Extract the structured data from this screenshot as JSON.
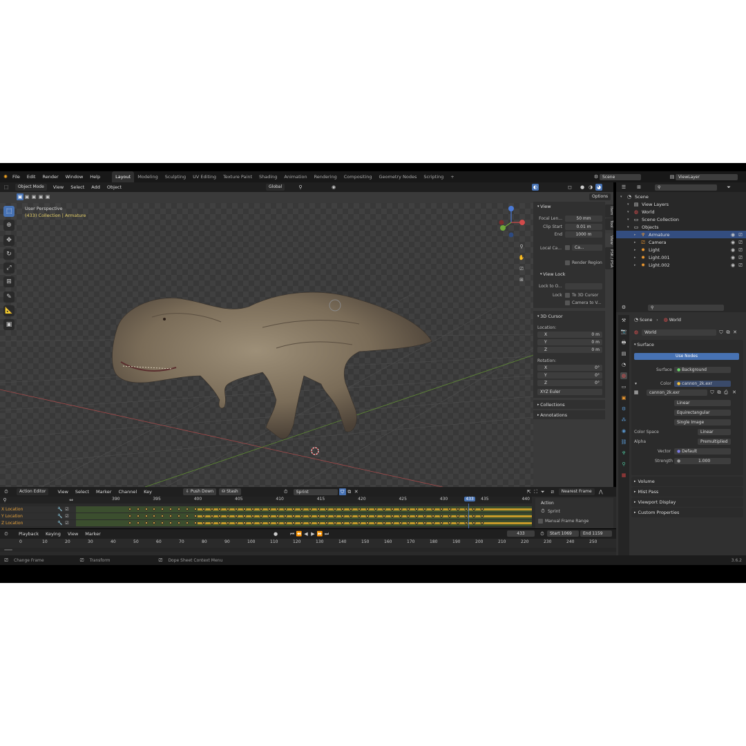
{
  "menu": {
    "items": [
      "File",
      "Edit",
      "Render",
      "Window",
      "Help"
    ]
  },
  "workspaces": [
    "Layout",
    "Modeling",
    "Sculpting",
    "UV Editing",
    "Texture Paint",
    "Shading",
    "Animation",
    "Rendering",
    "Compositing",
    "Geometry Nodes",
    "Scripting",
    "+"
  ],
  "scene": {
    "name": "Scene",
    "view_layer": "ViewLayer"
  },
  "viewport": {
    "mode": "Object Mode",
    "menus": [
      "View",
      "Select",
      "Add",
      "Object"
    ],
    "transform": "Global",
    "title": "User Perspective",
    "subtitle": "(433) Collection | Armature",
    "options": "Options"
  },
  "npanel": {
    "tabs": [
      "Item",
      "Tool",
      "View",
      "PSK / PSA"
    ],
    "view_header": "View",
    "focal_label": "Focal Len...",
    "focal_value": "50 mm",
    "clip_start_label": "Clip Start",
    "clip_start_value": "0.01 m",
    "end_label": "End",
    "end_value": "1000 m",
    "local_label": "Local Ca...",
    "local_value": "Ca...",
    "render_region": "Render Region",
    "view_lock_header": "View Lock",
    "lock_obj_label": "Lock to O...",
    "lock_label": "Lock",
    "to_cursor": "To 3D Cursor",
    "camera_to": "Camera to V...",
    "cursor_header": "3D Cursor",
    "location_label": "Location:",
    "loc": [
      {
        "axis": "X",
        "value": "0 m"
      },
      {
        "axis": "Y",
        "value": "0 m"
      },
      {
        "axis": "Z",
        "value": "0 m"
      }
    ],
    "rotation_label": "Rotation:",
    "rot": [
      {
        "axis": "X",
        "value": "0°"
      },
      {
        "axis": "Y",
        "value": "0°"
      },
      {
        "axis": "Z",
        "value": "0°"
      }
    ],
    "rot_mode": "XYZ Euler",
    "collections": "Collections",
    "annotations": "Annotations"
  },
  "outliner": {
    "rows": [
      {
        "label": "Scene",
        "indent": 0
      },
      {
        "label": "View Layers",
        "indent": 1
      },
      {
        "label": "World",
        "indent": 1
      },
      {
        "label": "Scene Collection",
        "indent": 1
      },
      {
        "label": "Objects",
        "indent": 1
      },
      {
        "label": "Armature",
        "indent": 2
      },
      {
        "label": "Camera",
        "indent": 2
      },
      {
        "label": "Light",
        "indent": 2
      },
      {
        "label": "Light.001",
        "indent": 2
      },
      {
        "label": "Light.002",
        "indent": 2
      }
    ]
  },
  "properties": {
    "breadcrumb_scene": "Scene",
    "breadcrumb_world": "World",
    "world_name": "World",
    "surface_header": "Surface",
    "use_nodes": "Use Nodes",
    "surface_label": "Surface",
    "surface_value": "Background",
    "color_label": "Color",
    "color_value": "cannon_2k.exr",
    "image_name": "cannon_2k.exr",
    "interp": "Linear",
    "projection": "Equirectangular",
    "source": "Single Image",
    "colorspace_label": "Color Space",
    "colorspace_value": "Linear",
    "alpha_label": "Alpha",
    "alpha_value": "Premultiplied",
    "vector_label": "Vector",
    "vector_value": "Default",
    "strength_label": "Strength",
    "strength_value": "1.000",
    "sections": [
      "Volume",
      "Mist Pass",
      "Viewport Display",
      "Custom Properties"
    ]
  },
  "dopesheet": {
    "mode": "Action Editor",
    "menus": [
      "View",
      "Select",
      "Marker",
      "Channel",
      "Key"
    ],
    "push_down": "Push Down",
    "stash": "Stash",
    "action": "Sprint",
    "snap": "Nearest Frame",
    "ticks": [
      "390",
      "395",
      "400",
      "405",
      "410",
      "415",
      "420",
      "425",
      "430",
      "433",
      "435",
      "440"
    ],
    "channels": [
      "X Location",
      "Y Location",
      "Z Location"
    ],
    "side_header": "Action",
    "side_action": "Sprint",
    "manual_range": "Manual Frame Range"
  },
  "timeline": {
    "menus": [
      "Playback",
      "Keying",
      "View",
      "Marker"
    ],
    "current": "433",
    "start": "Start  1069",
    "end": "End  1159",
    "ticks": [
      "0",
      "10",
      "20",
      "30",
      "40",
      "50",
      "60",
      "70",
      "80",
      "90",
      "100",
      "110",
      "120",
      "130",
      "140",
      "150",
      "160",
      "170",
      "180",
      "190",
      "200",
      "210",
      "220",
      "230",
      "240",
      "250"
    ]
  },
  "status": {
    "items": [
      "Change Frame",
      "Transform",
      "Dope Sheet Context Menu"
    ],
    "version": "3.6.2"
  }
}
